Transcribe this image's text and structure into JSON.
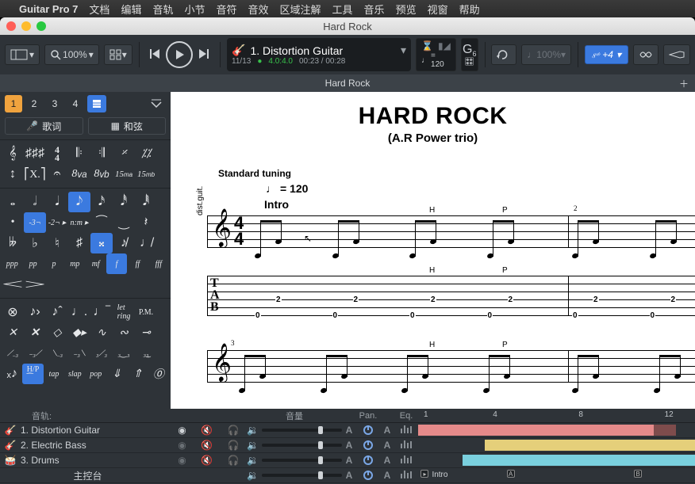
{
  "menubar": {
    "app": "Guitar Pro 7",
    "items": [
      "文档",
      "编辑",
      "音轨",
      "小节",
      "音符",
      "音效",
      "区域注解",
      "工具",
      "音乐",
      "预览",
      "视窗",
      "帮助"
    ]
  },
  "window": {
    "title": "Hard Rock"
  },
  "toolbar": {
    "zoom": "100%",
    "current_track": "1. Distortion Guitar",
    "bar_pos": "11/13",
    "loop": "4.0:4.0",
    "time": "00:23 / 00:28",
    "tempo": "= 120",
    "key_letter": "G",
    "key_sub": "6",
    "speed_pct": "100%",
    "transpose": "+4"
  },
  "document_tab": {
    "title": "Hard Rock"
  },
  "palette": {
    "pages": [
      "1",
      "2",
      "3",
      "4"
    ],
    "lyrics": "歌词",
    "chords": "和弦"
  },
  "score": {
    "song_title": "HARD ROCK",
    "subtitle": "(A.R Power trio)",
    "tuning": "Standard tuning",
    "tempo_value": "= 120",
    "section": "Intro",
    "track_short": "dist.guit.",
    "time_sig_top": "4",
    "time_sig_bot": "4",
    "ann_h": "H",
    "ann_p": "P",
    "barnum_2": "2",
    "barnum_3": "3",
    "tab_a": "0",
    "tab_b": "2"
  },
  "mixer": {
    "head": {
      "track": "音轨:",
      "volume": "音量",
      "pan": "Pan.",
      "eq": "Eq."
    },
    "ticks": [
      "1",
      "4",
      "8",
      "12"
    ],
    "tracks": [
      {
        "name": "1. Distortion Guitar",
        "color": "#e5cf7a"
      },
      {
        "name": "2. Electric Bass",
        "color": "#e5cf7a"
      },
      {
        "name": "3. Drums",
        "color": "#7ad0de"
      }
    ],
    "master": "主控台",
    "intro_label": "Intro",
    "marker_a": "A",
    "marker_b": "B"
  }
}
